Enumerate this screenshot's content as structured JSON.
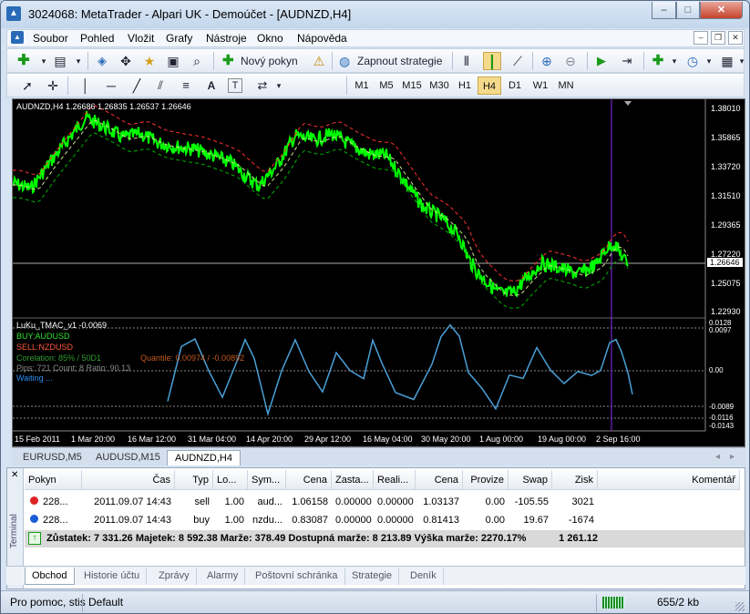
{
  "window": {
    "title": "3024068: MetaTrader - Alpari UK - Demoúčet - [AUDNZD,H4]",
    "minimize": "–",
    "maximize": "□",
    "close": "✕"
  },
  "menu": [
    "Soubor",
    "Pohled",
    "Vložit",
    "Grafy",
    "Nástroje",
    "Okno",
    "Nápověda"
  ],
  "mdi": {
    "minimize": "–",
    "restore": "❐",
    "close": "✕"
  },
  "toolbar": {
    "new_order": "Nový pokyn",
    "strategies": "Zapnout strategie"
  },
  "drawing_tools": {
    "text_tool": "A",
    "label_tool": "T"
  },
  "timeframes": [
    "M1",
    "M5",
    "M15",
    "M30",
    "H1",
    "H4",
    "D1",
    "W1",
    "MN"
  ],
  "active_timeframe": "H4",
  "chart": {
    "header": "AUDNZD,H4  1.26686 1.26835 1.26537 1.26646",
    "price_labels": [
      "1.38010",
      "1.35865",
      "1.33720",
      "1.31510",
      "1.29365",
      "1.27220",
      "1.25075",
      "1.22930"
    ],
    "current_price": "1.26646",
    "time_labels": [
      "15 Feb 2011",
      "1 Mar 20:00",
      "16 Mar 12:00",
      "31 Mar 04:00",
      "14 Apr 20:00",
      "29 Apr 12:00",
      "16 May 04:00",
      "30 May 20:00",
      "1 Aug 00:00",
      "19 Aug 00:00",
      "2 Sep 16:00"
    ],
    "colors": {
      "price": "#00ff00",
      "upper_band": "#ff3030",
      "lower_band": "#00b000",
      "indicator": "#4aa0d8",
      "cursor_line": "#8a2be2"
    }
  },
  "indicator": {
    "name": "LuKu_TMAC_v1 -0.0069",
    "buy": "BUY:AUDUSD",
    "sell": "SELL:NZDUSD",
    "correlation": "Corelation: 85% / 50D1",
    "quantile": "Quantile: 0.00974 / -0.00892",
    "pips": "Pips: 721 Count: 8 Ratio: 90.13",
    "status": "Waiting ...",
    "levels": [
      "0.0128",
      "0.0097",
      "0.00",
      "-0.0089",
      "-0.0116",
      "-0.0143"
    ]
  },
  "chart_tabs": [
    "EURUSD,M5",
    "AUDUSD,M15",
    "AUDNZD,H4"
  ],
  "active_chart_tab": "AUDNZD,H4",
  "terminal": {
    "side_label": "Terminal",
    "columns": [
      "Pokyn",
      "Čas",
      "Typ",
      "Lo...",
      "Sym...",
      "Cena",
      "Zasta...",
      "Reali...",
      "Cena",
      "Provize",
      "Swap",
      "Zisk",
      "Komentář"
    ],
    "rows": [
      {
        "ticket": "228...",
        "time": "2011.09.07 14:43",
        "type": "sell",
        "lots": "1.00",
        "symbol": "aud...",
        "price": "1.06158",
        "sl": "0.00000",
        "tp": "0.00000",
        "cur_price": "1.03137",
        "commission": "0.00",
        "swap": "-105.55",
        "profit": "3021",
        "comment": ""
      },
      {
        "ticket": "228...",
        "time": "2011.09.07 14:43",
        "type": "buy",
        "lots": "1.00",
        "symbol": "nzdu...",
        "price": "0.83087",
        "sl": "0.00000",
        "tp": "0.00000",
        "cur_price": "0.81413",
        "commission": "0.00",
        "swap": "19.67",
        "profit": "-1674",
        "comment": ""
      }
    ],
    "balance": "Zůstatek: 7 331.26  Majetek: 8 592.38  Marže: 378.49  Dostupná marže: 8 213.89  Výška marže: 2270.17%",
    "total_profit": "1 261.12",
    "tabs": [
      "Obchod",
      "Historie účtu",
      "Zprávy",
      "Alarmy",
      "Poštovní schránka",
      "Strategie",
      "Deník"
    ],
    "active_tab": "Obchod"
  },
  "status": {
    "help": "Pro pomoc, stis",
    "profile": "Default",
    "traffic": "655/2 kb"
  }
}
